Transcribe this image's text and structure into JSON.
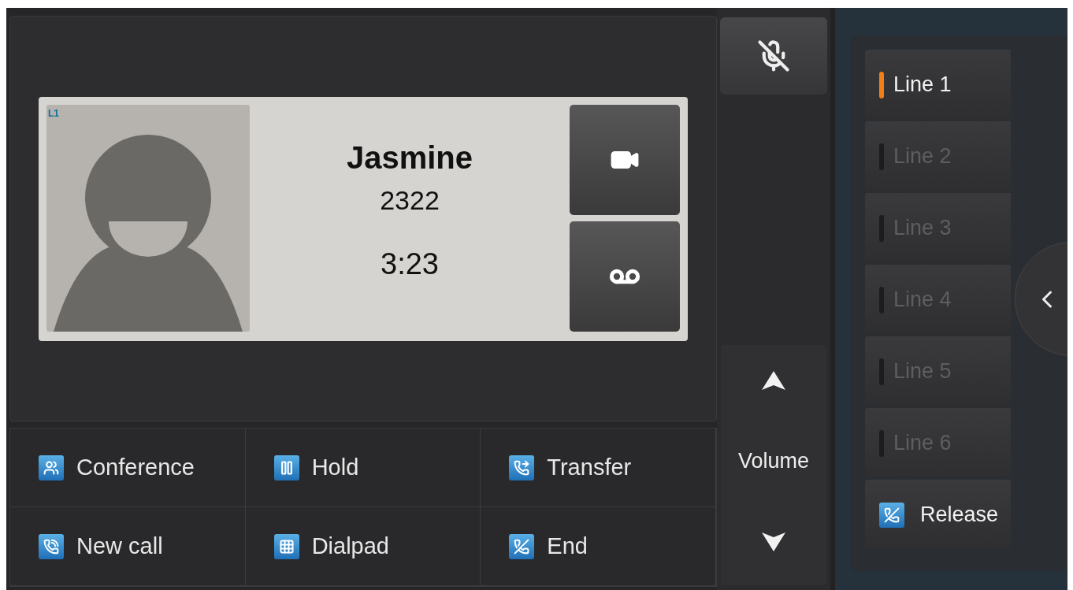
{
  "call": {
    "line_badge": "L1",
    "name": "Jasmine",
    "number": "2322",
    "duration": "3:23"
  },
  "actions": [
    {
      "label": "Conference",
      "kind": "conference"
    },
    {
      "label": "Hold",
      "kind": "hold"
    },
    {
      "label": "Transfer",
      "kind": "transfer"
    },
    {
      "label": "New call",
      "kind": "newcall"
    },
    {
      "label": "Dialpad",
      "kind": "dialpad"
    },
    {
      "label": "End",
      "kind": "end"
    }
  ],
  "volume": {
    "label": "Volume"
  },
  "lines": [
    {
      "label": "Line 1",
      "selected": true
    },
    {
      "label": "Line 2",
      "selected": false
    },
    {
      "label": "Line 3",
      "selected": false
    },
    {
      "label": "Line 4",
      "selected": false
    },
    {
      "label": "Line 5",
      "selected": false
    },
    {
      "label": "Line 6",
      "selected": false
    }
  ],
  "release": {
    "label": "Release"
  }
}
